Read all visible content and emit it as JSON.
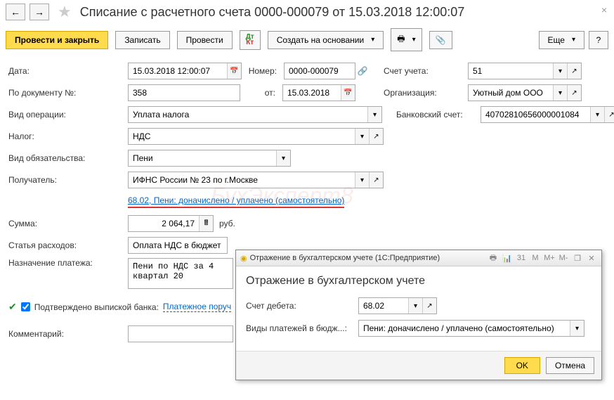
{
  "header": {
    "title": "Списание с расчетного счета 0000-000079 от 15.03.2018 12:00:07"
  },
  "toolbar": {
    "post_close": "Провести и закрыть",
    "save": "Записать",
    "post": "Провести",
    "create_based": "Создать на основании",
    "more": "Еще",
    "help": "?"
  },
  "form": {
    "date_label": "Дата:",
    "date_value": "15.03.2018 12:00:07",
    "number_label": "Номер:",
    "number_value": "0000-000079",
    "account_label": "Счет учета:",
    "account_value": "51",
    "docnum_label": "По документу №:",
    "docnum_value": "358",
    "from_label": "от:",
    "from_value": "15.03.2018",
    "org_label": "Организация:",
    "org_value": "Уютный дом ООО",
    "optype_label": "Вид операции:",
    "optype_value": "Уплата налога",
    "bankacc_label": "Банковский счет:",
    "bankacc_value": "40702810656000001084",
    "tax_label": "Налог:",
    "tax_value": "НДС",
    "obligation_label": "Вид обязательства:",
    "obligation_value": "Пени",
    "recipient_label": "Получатель:",
    "recipient_value": "ИФНС России № 23 по г.Москве",
    "reflection_link": "68.02, Пени: доначислено / уплачено (самостоятельно)",
    "sum_label": "Сумма:",
    "sum_value": "2 064,17",
    "currency": "руб.",
    "expense_label": "Статья расходов:",
    "expense_value": "Оплата НДС в бюджет",
    "purpose_label": "Назначение платежа:",
    "purpose_value": "Пени по НДС за 4 квартал 20",
    "confirmed_label": "Подтверждено выпиской банка:",
    "payment_order_link": "Платежное поруч",
    "comment_label": "Комментарий:"
  },
  "modal": {
    "titlebar": "Отражение в бухгалтерском учете  (1С:Предприятие)",
    "heading": "Отражение в бухгалтерском учете",
    "debit_label": "Счет дебета:",
    "debit_value": "68.02",
    "paytype_label": "Виды платежей в бюдж...:",
    "paytype_value": "Пени: доначислено / уплачено (самостоятельно)",
    "ok": "OK",
    "cancel": "Отмена",
    "tb_m": "M",
    "tb_mplus": "M+",
    "tb_mminus": "M-"
  },
  "watermark": "БухЭксперт8"
}
